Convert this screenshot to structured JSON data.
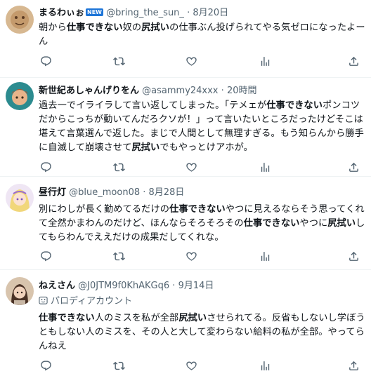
{
  "tweets": [
    {
      "display_name": "まるわぃぉ",
      "badge": "NEW",
      "handle": "@bring_the_sun_",
      "dot": "·",
      "time": "8月20日",
      "body": [
        {
          "t": "朝から"
        },
        {
          "b": "仕事できない"
        },
        {
          "t": "奴の"
        },
        {
          "b": "尻拭い"
        },
        {
          "t": "の仕事ぶん投げられてやる気ゼロになったよーん"
        }
      ],
      "avatar_colors": [
        "#c9a57a",
        "#7a4e2d"
      ]
    },
    {
      "display_name": "新世紀あしゃんげりをん",
      "handle": "@asammy24xxx",
      "dot": "·",
      "time": "20時間",
      "body": [
        {
          "t": "過去一でイライラして言い返してしまった。「テメェが"
        },
        {
          "b": "仕事できない"
        },
        {
          "t": "ポンコツだからこっちが動いてんだろクソが！」って言いたいところだったけどそこは堪えて言葉選んで返した。まじで人間として無理すぎる。もう知らんから勝手に自滅して崩壊させて"
        },
        {
          "b": "尻拭い"
        },
        {
          "t": "でもやっとけアホが。"
        }
      ],
      "avatar_colors": [
        "#2a8a8c",
        "#d08a3a"
      ]
    },
    {
      "display_name": "昼行灯",
      "handle": "@blue_moon08",
      "dot": "·",
      "time": "8月28日",
      "body": [
        {
          "t": "別にわしが長く勤めてるだけの"
        },
        {
          "b": "仕事できない"
        },
        {
          "t": "やつに見えるならそう思ってくれて全然かまわんのだけど、ほんならそろそろその"
        },
        {
          "b": "仕事できない"
        },
        {
          "t": "やつに"
        },
        {
          "b": "尻拭い"
        },
        {
          "t": "してもらわんでええだけの成果だしてくれな。"
        }
      ],
      "avatar_colors": [
        "#e8d7ef",
        "#b07acb"
      ]
    },
    {
      "display_name": "ねえさん",
      "handle": "@J0JTM9f0KhAKGq6",
      "dot": "·",
      "time": "9月14日",
      "parody_label": "パロディアカウント",
      "body": [
        {
          "b": "仕事できない"
        },
        {
          "t": "人のミスを私が全部"
        },
        {
          "b": "尻拭い"
        },
        {
          "t": "させられてる。反省もしないし学ぼうともしない人のミスを、その人と大して変わらない給料の私が全部。やってらんねえ"
        }
      ],
      "avatar_colors": [
        "#d9c2a8",
        "#6b4a36"
      ]
    }
  ],
  "icons": {
    "reply": "reply-icon",
    "retweet": "retweet-icon",
    "like": "like-icon",
    "views": "views-icon",
    "share": "share-icon",
    "parody": "parody-mask-icon"
  },
  "colors": {
    "text": "#0f1419",
    "muted": "#536471",
    "divider": "#eff3f4"
  }
}
